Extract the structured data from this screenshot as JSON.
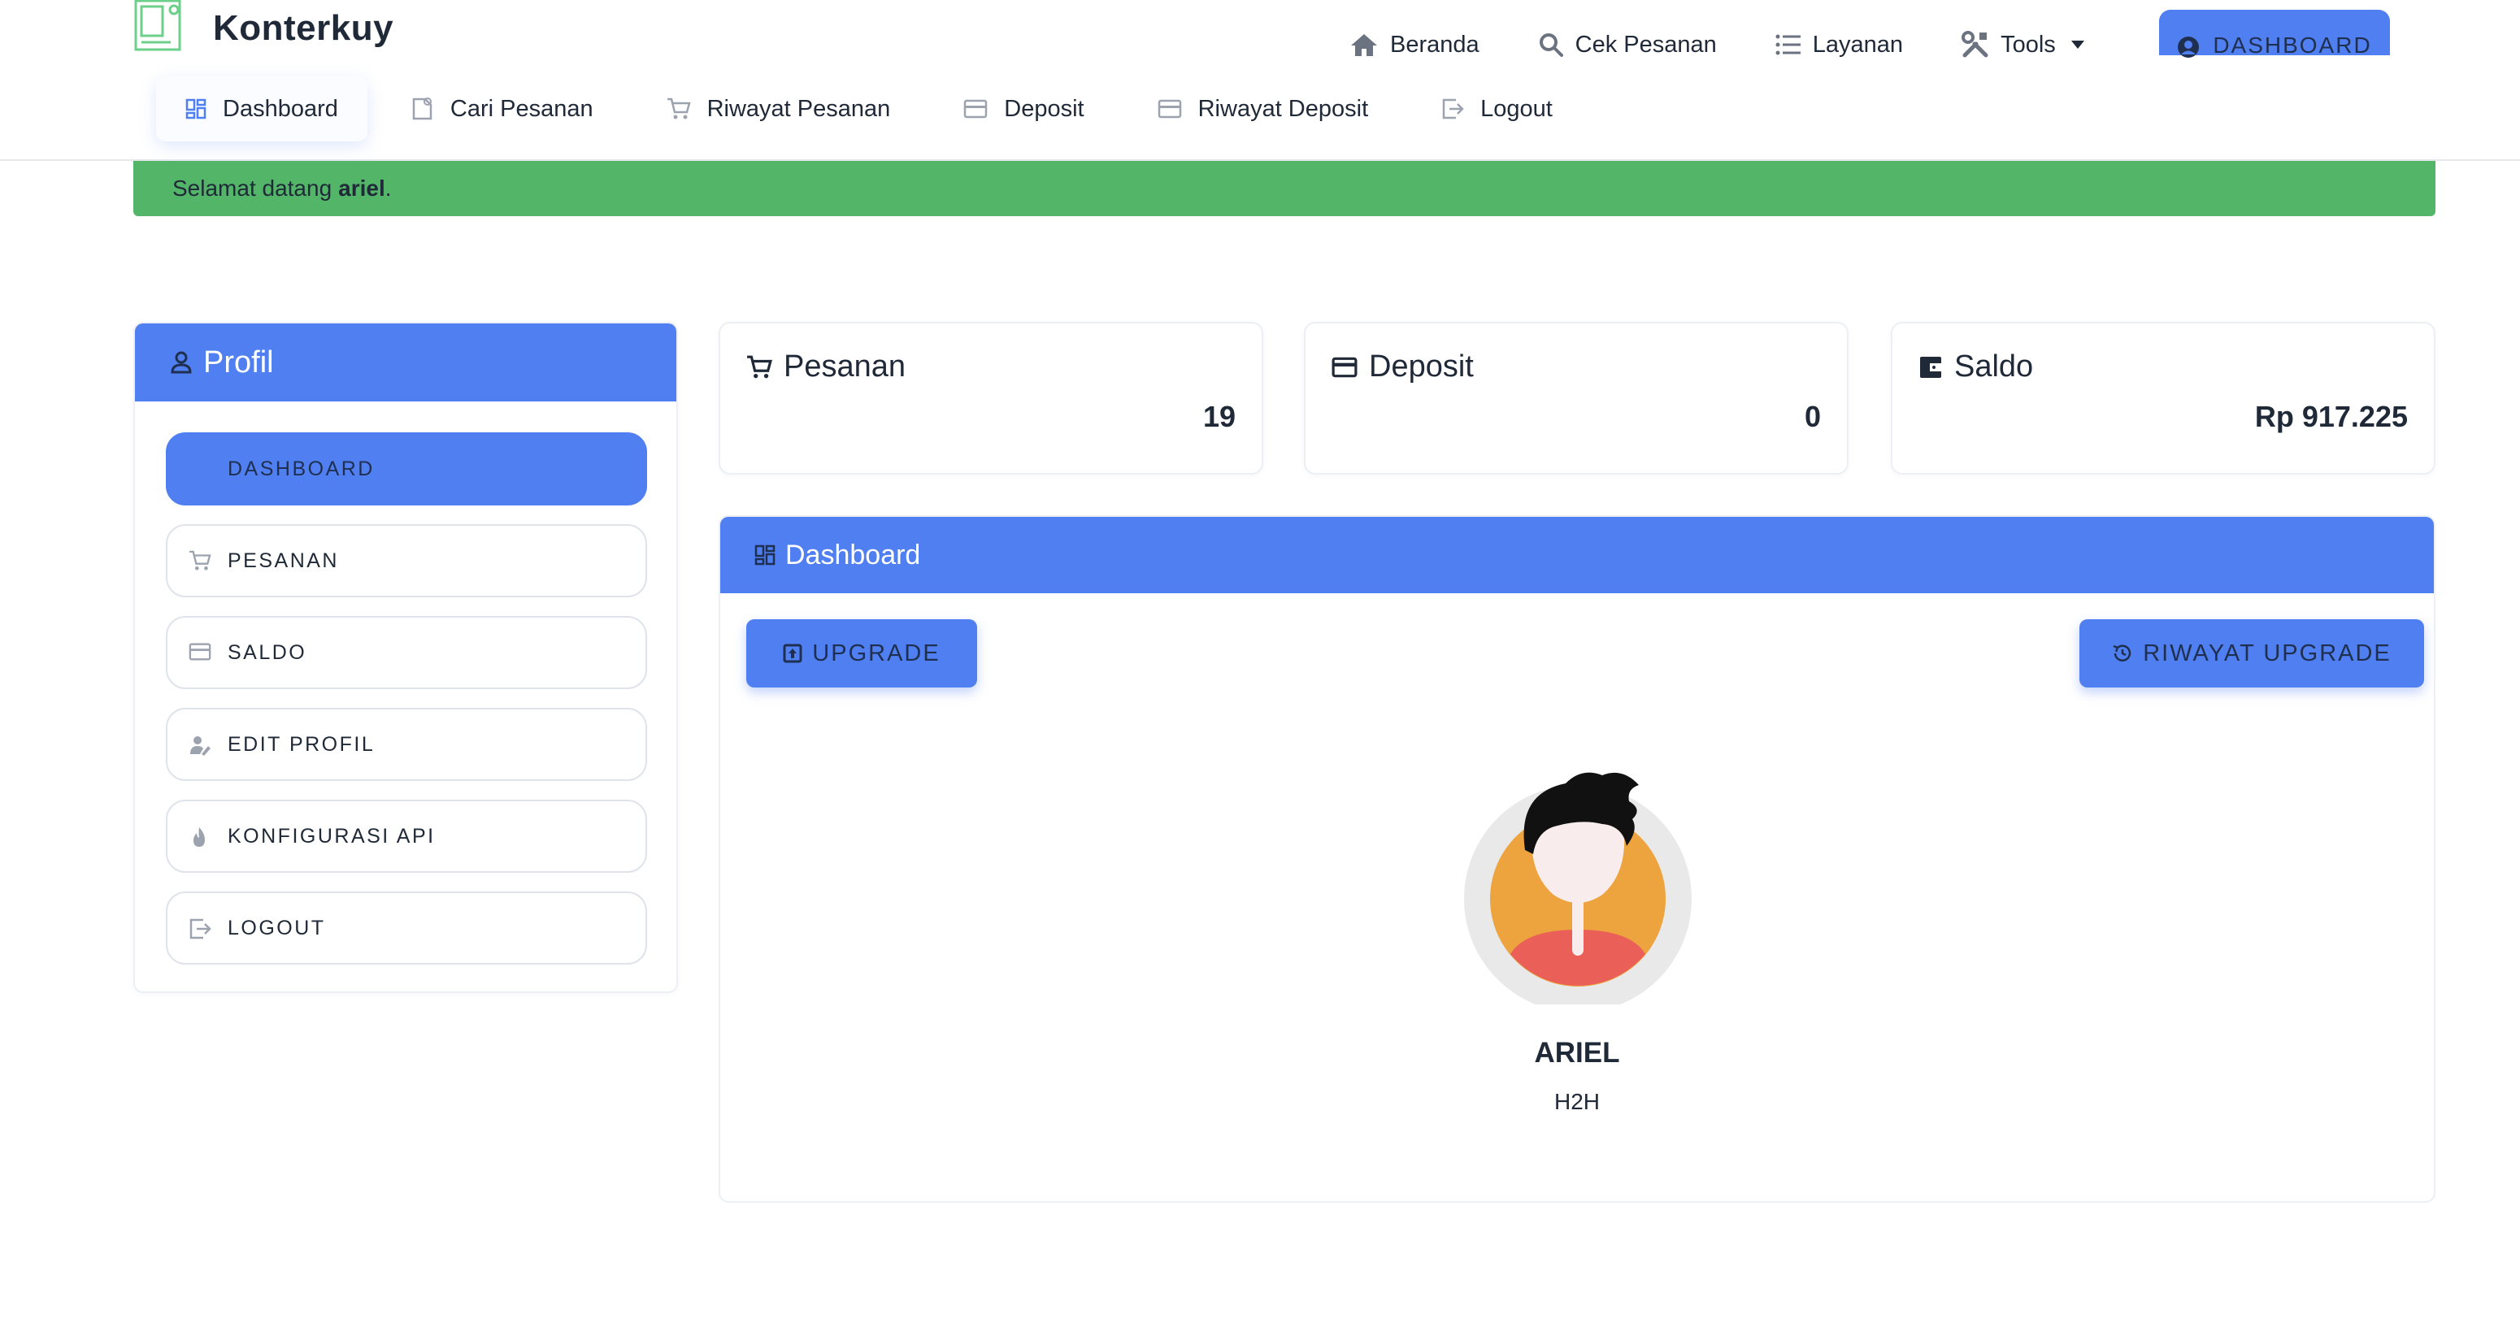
{
  "brand": {
    "name": "Konterkuy",
    "accent": "#4f7ff0",
    "success": "#53b568"
  },
  "topnav": {
    "items": [
      {
        "label": "Beranda",
        "icon": "home-icon"
      },
      {
        "label": "Cek Pesanan",
        "icon": "search-icon"
      },
      {
        "label": "Layanan",
        "icon": "list-icon"
      },
      {
        "label": "Tools",
        "icon": "tools-icon"
      }
    ],
    "dashboard_button": "DASHBOARD"
  },
  "subnav": {
    "items": [
      {
        "label": "Dashboard",
        "icon": "grid-icon",
        "active": true
      },
      {
        "label": "Cari Pesanan",
        "icon": "search-doc-icon"
      },
      {
        "label": "Riwayat Pesanan",
        "icon": "cart-icon"
      },
      {
        "label": "Deposit",
        "icon": "card-icon"
      },
      {
        "label": "Riwayat Deposit",
        "icon": "card-icon"
      },
      {
        "label": "Logout",
        "icon": "logout-icon"
      }
    ]
  },
  "alert": {
    "prefix": "Selamat datang",
    "username": "ariel",
    "suffix": "."
  },
  "profile": {
    "title": "Profil",
    "menu": [
      {
        "label": "DASHBOARD",
        "icon": "grid-icon",
        "active": true
      },
      {
        "label": "PESANAN",
        "icon": "cart-icon"
      },
      {
        "label": "SALDO",
        "icon": "card-icon"
      },
      {
        "label": "EDIT PROFIL",
        "icon": "user-edit-icon"
      },
      {
        "label": "KONFIGURASI API",
        "icon": "fire-icon"
      },
      {
        "label": "LOGOUT",
        "icon": "logout-icon"
      }
    ]
  },
  "stats": [
    {
      "title": "Pesanan",
      "value": "19",
      "icon": "cart-icon"
    },
    {
      "title": "Deposit",
      "value": "0",
      "icon": "card-icon"
    },
    {
      "title": "Saldo",
      "value": "Rp 917.225",
      "icon": "wallet-icon"
    }
  ],
  "dashboard": {
    "title": "Dashboard",
    "upgrade_button": "UPGRADE",
    "history_button": "RIWAYAT UPGRADE",
    "user_name": "ARIEL",
    "user_role": "H2H"
  }
}
